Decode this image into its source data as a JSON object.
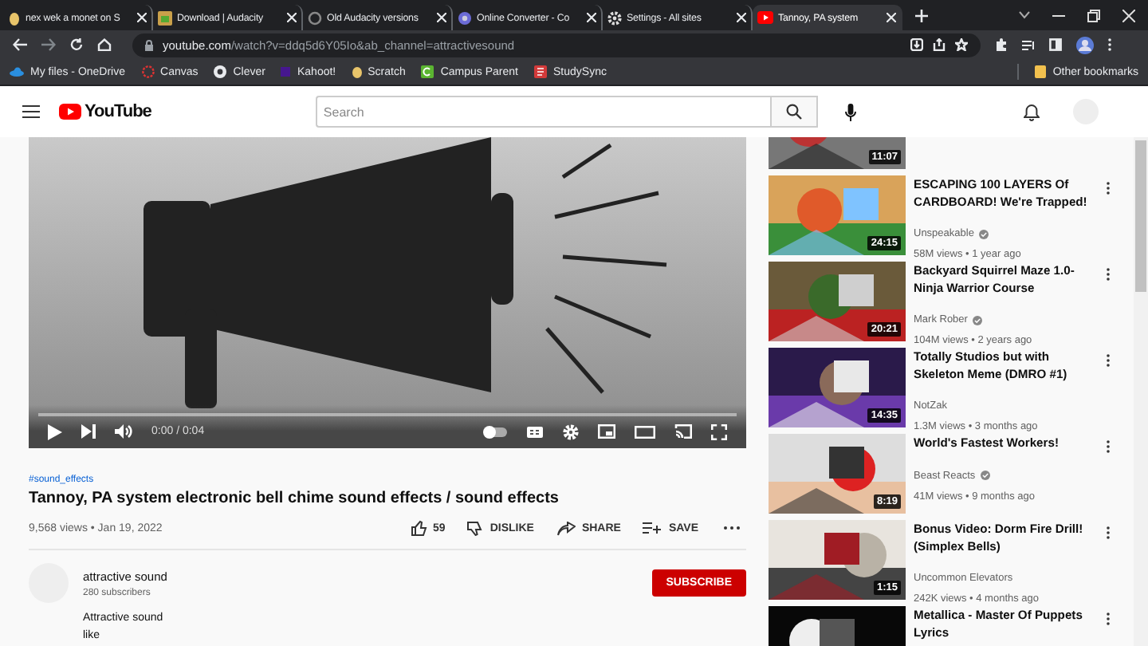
{
  "browser": {
    "tabs": [
      {
        "title": "nex wek a monet on S",
        "selected": false
      },
      {
        "title": "Download | Audacity",
        "selected": false
      },
      {
        "title": "Old Audacity versions",
        "selected": false
      },
      {
        "title": "Online Converter - Co",
        "selected": false
      },
      {
        "title": "Settings - All sites",
        "selected": false
      },
      {
        "title": "Tannoy, PA system",
        "selected": true
      }
    ],
    "url": {
      "host": "youtube.com",
      "path": "/watch?v=ddq5d6Y05Io&ab_channel=attractivesound"
    },
    "bookmarks": [
      "My files - OneDrive",
      "Canvas",
      "Clever",
      "Kahoot!",
      "Scratch",
      "Campus Parent",
      "StudySync"
    ],
    "other_bookmarks": "Other bookmarks"
  },
  "youtube": {
    "logo": "YouTube",
    "search": {
      "placeholder": "Search"
    }
  },
  "player": {
    "time": "0:00 / 0:04",
    "level": 0,
    "autoplay": false
  },
  "video": {
    "hashtag": "#sound_effects",
    "title": "Tannoy, PA system electronic bell chime sound effects / sound effects",
    "stats": "9,568 views • Jan 19, 2022",
    "likes": "59",
    "actions": [
      "DISLIKE",
      "SHARE",
      "SAVE"
    ],
    "channel": {
      "name": "attractive sound",
      "subscribers": "280 subscribers",
      "subscribe": "SUBSCRIBE"
    },
    "description": [
      "Attractive sound",
      "like"
    ]
  },
  "recommendations": [
    {
      "duration": "11:07"
    },
    {
      "title": "ESCAPING 100 LAYERS Of CARDBOARD! We're Trapped!",
      "channel": "Unspeakable",
      "verified": true,
      "meta": "58M views • 1 year ago",
      "duration": "24:15"
    },
    {
      "title": "Backyard Squirrel Maze 1.0-Ninja Warrior Course",
      "channel": "Mark Rober",
      "verified": true,
      "meta": "104M views • 2 years ago",
      "duration": "20:21"
    },
    {
      "title": "Totally Studios but with Skeleton Meme (DMRO #1)",
      "channel": "NotZak",
      "verified": false,
      "meta": "1.3M views • 3 months ago",
      "duration": "14:35"
    },
    {
      "title": "World's Fastest Workers!",
      "channel": "Beast Reacts",
      "verified": true,
      "meta": "41M views • 9 months ago",
      "duration": "8:19"
    },
    {
      "title": "Bonus Video: Dorm Fire Drill! (Simplex Bells)",
      "channel": "Uncommon Elevators",
      "verified": false,
      "meta": "242K views • 4 months ago",
      "duration": "1:15"
    },
    {
      "title": "Metallica - Master Of Puppets Lyrics"
    }
  ]
}
